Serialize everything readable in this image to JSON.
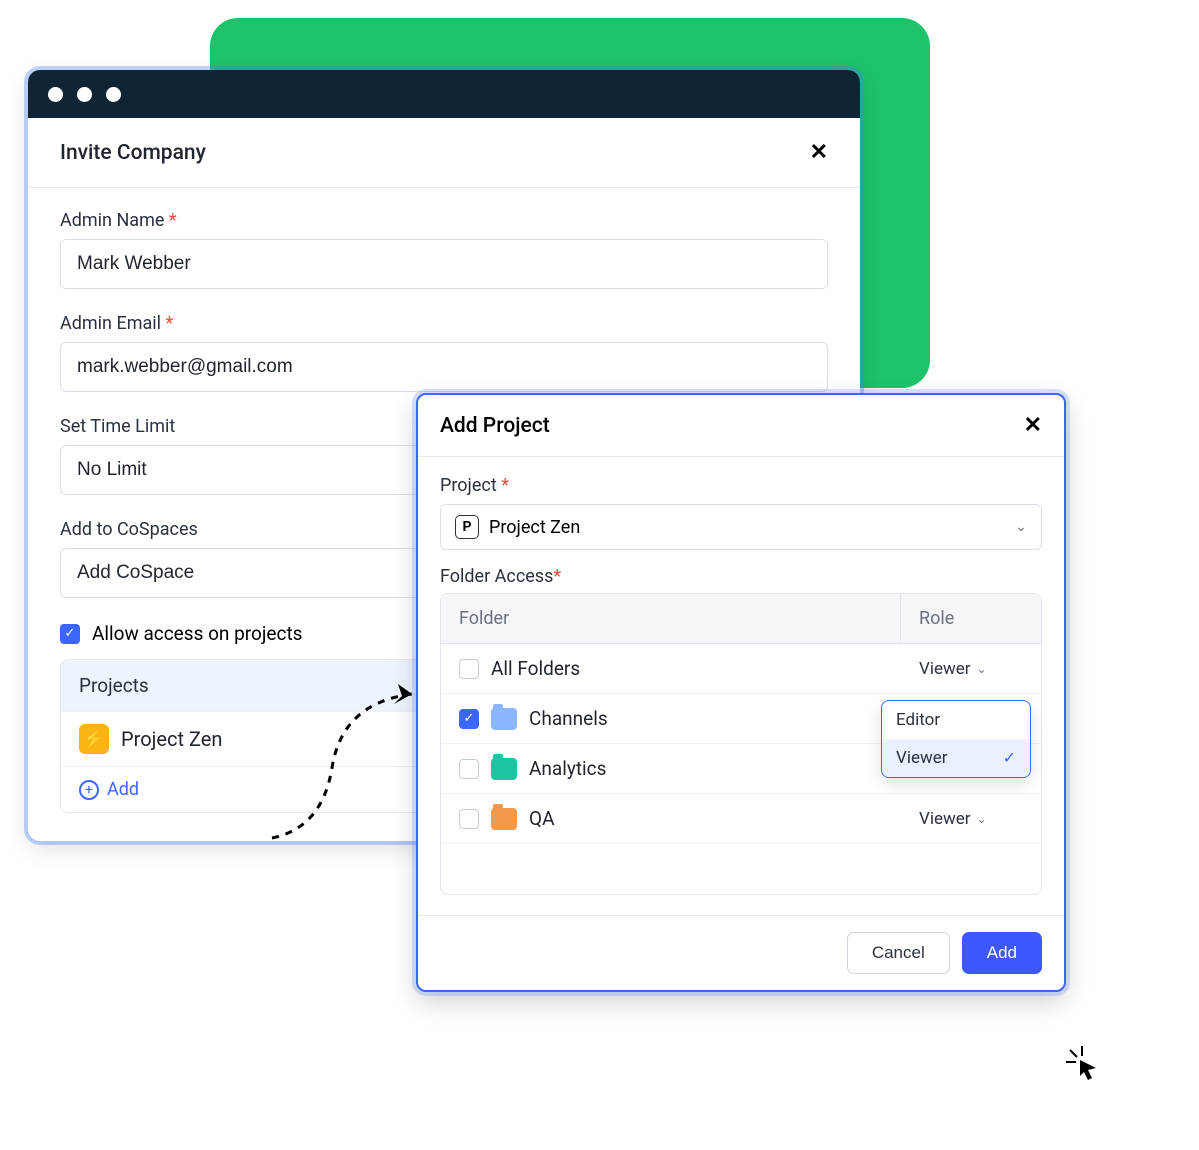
{
  "invite": {
    "title": "Invite Company",
    "admin_name_label": "Admin Name",
    "admin_name_value": "Mark Webber",
    "admin_email_label": "Admin Email",
    "admin_email_value": "mark.webber@gmail.com",
    "time_limit_label": "Set Time Limit",
    "time_limit_value": "No Limit",
    "cospaces_label": "Add to CoSpaces",
    "cospaces_value": "Add CoSpace",
    "allow_access_label": "Allow access on projects",
    "projects_header": "Projects",
    "project_item": "Project Zen",
    "add_label": "Add"
  },
  "add_project": {
    "title": "Add Project",
    "project_label": "Project",
    "project_value": "Project Zen",
    "folder_access_label": "Folder Access",
    "col_folder": "Folder",
    "col_role": "Role",
    "rows": [
      {
        "name": "All Folders",
        "role": "Viewer",
        "checked": false,
        "icon": "none"
      },
      {
        "name": "Channels",
        "role": "Viewer",
        "checked": true,
        "icon": "blue",
        "dropdown_open": true
      },
      {
        "name": "Analytics",
        "role": "Viewer",
        "checked": false,
        "icon": "teal"
      },
      {
        "name": "QA",
        "role": "Viewer",
        "checked": false,
        "icon": "orange"
      }
    ],
    "role_options": [
      "Editor",
      "Viewer"
    ],
    "role_selected": "Viewer",
    "cancel_label": "Cancel",
    "add_label": "Add"
  }
}
